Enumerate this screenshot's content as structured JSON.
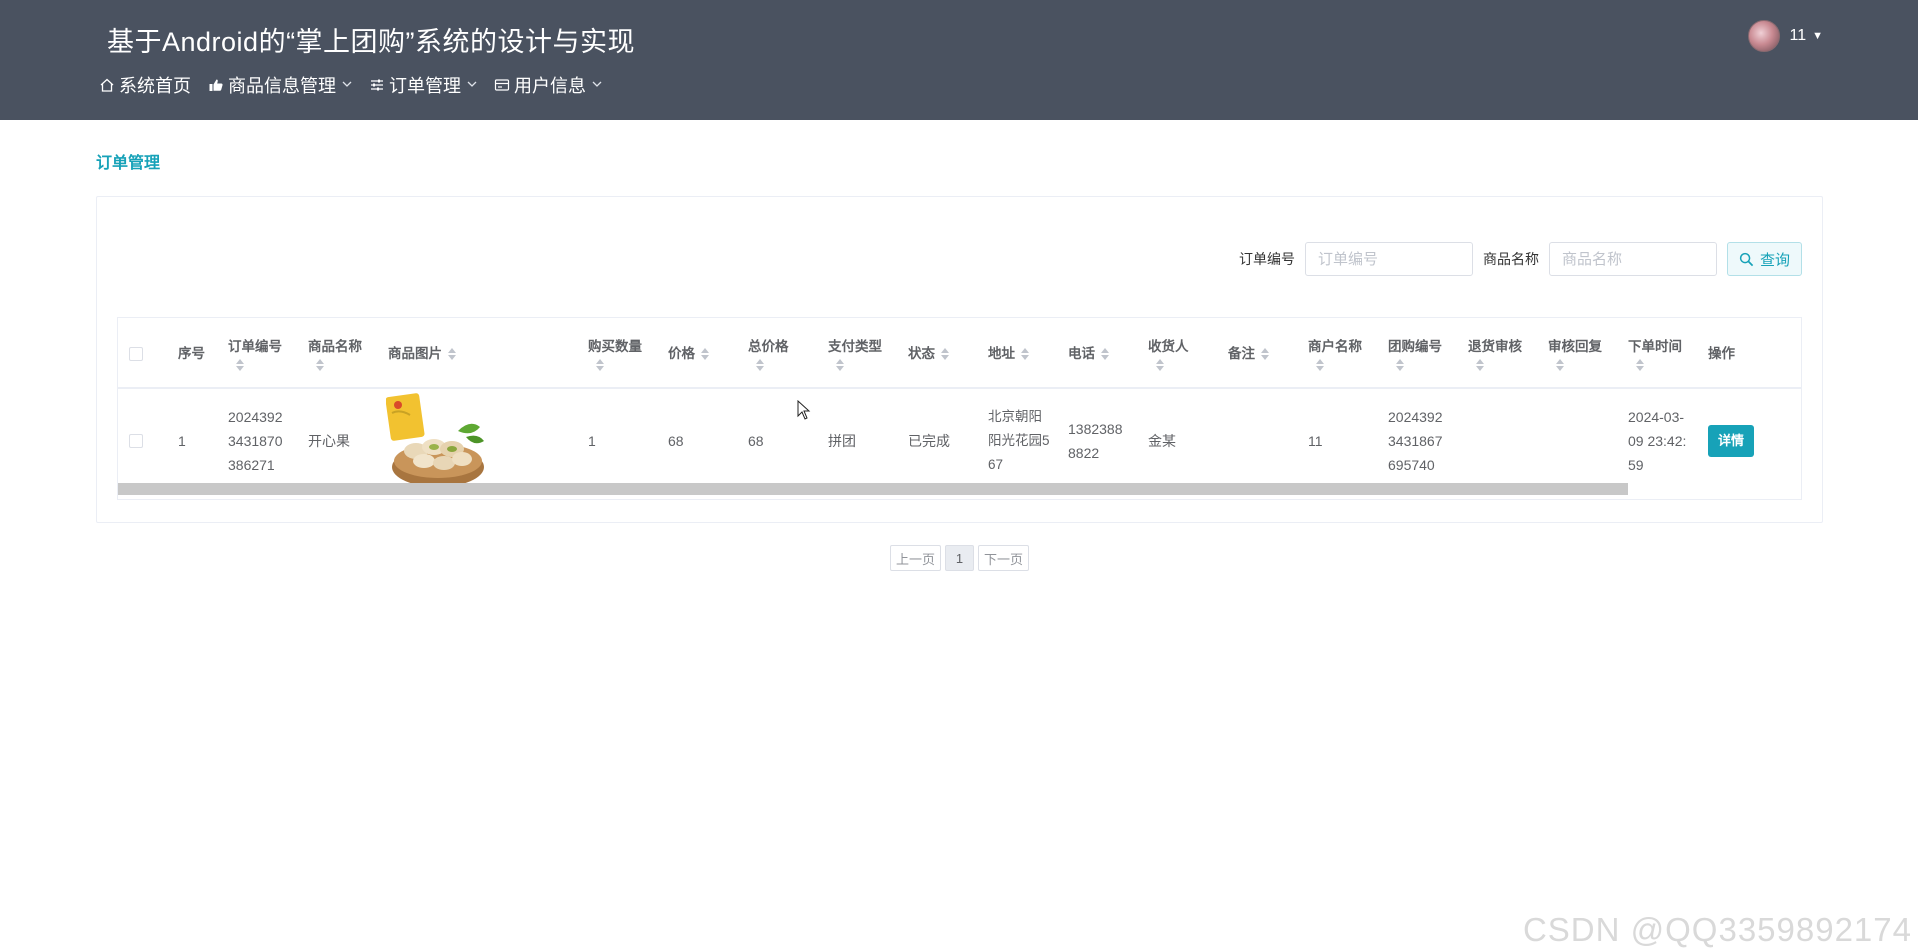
{
  "header": {
    "title": "基于Android的“掌上团购”系统的设计与实现",
    "nav": [
      {
        "label": "系统首页",
        "icon": "home-icon",
        "has_dropdown": false
      },
      {
        "label": "商品信息管理",
        "icon": "thumbs-up-icon",
        "has_dropdown": true
      },
      {
        "label": "订单管理",
        "icon": "sliders-icon",
        "has_dropdown": true
      },
      {
        "label": "用户信息",
        "icon": "card-icon",
        "has_dropdown": true
      }
    ],
    "user": {
      "name": "11"
    }
  },
  "breadcrumb": "订单管理",
  "search": {
    "order_no_label": "订单编号",
    "order_no_placeholder": "订单编号",
    "product_name_label": "商品名称",
    "product_name_placeholder": "商品名称",
    "button_label": "查询"
  },
  "table": {
    "columns": [
      "序号",
      "订单编号",
      "商品名称",
      "商品图片",
      "购买数量",
      "价格",
      "总价格",
      "支付类型",
      "状态",
      "地址",
      "电话",
      "收货人",
      "备注",
      "商户名称",
      "团购编号",
      "退货审核",
      "审核回复",
      "下单时间",
      "操作"
    ],
    "rows": [
      {
        "index": "1",
        "order_no": "20243923431870386271",
        "product_name": "开心果",
        "product_image": "pistachio-image",
        "quantity": "1",
        "price": "68",
        "total": "68",
        "pay_type": "拼团",
        "status": "已完成",
        "address": "北京朝阳阳光花园567",
        "phone": "13823888822",
        "receiver": "金某",
        "note": "",
        "merchant": "11",
        "group_no": "20243923431867695740",
        "refund_review": "",
        "review_reply": "",
        "order_time": "2024-03-09 23:42:59",
        "action": "详情"
      }
    ]
  },
  "pagination": {
    "prev": "上一页",
    "current": "1",
    "next": "下一页"
  },
  "watermark": "CSDN @QQ3359892174",
  "colors": {
    "header_bg": "#4a5260",
    "accent": "#17a2b8"
  }
}
